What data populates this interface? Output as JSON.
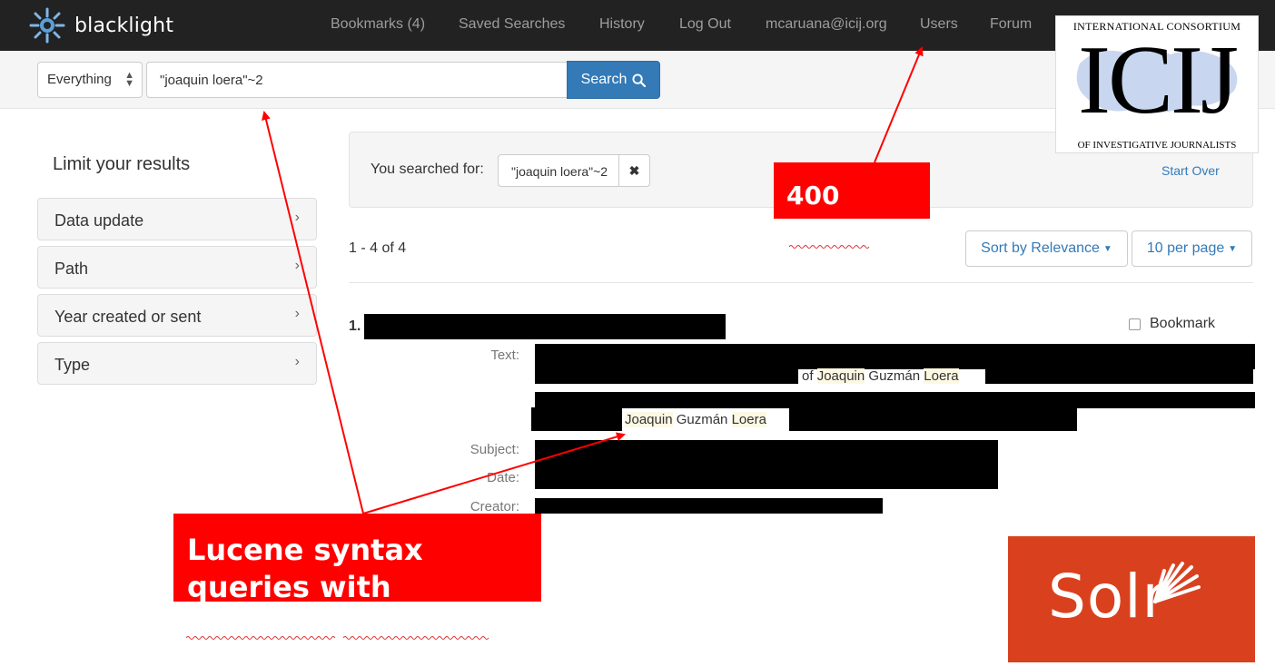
{
  "navbar": {
    "brand": "blacklight",
    "links": [
      "Bookmarks (4)",
      "Saved Searches",
      "History",
      "Log Out",
      "mcaruana@icij.org",
      "Users",
      "Forum"
    ]
  },
  "search": {
    "field": "Everything",
    "query": "\"joaquin loera\"~2",
    "button": "Search"
  },
  "sidebar": {
    "title": "Limit your results",
    "facets": [
      "Data update",
      "Path",
      "Year created or sent",
      "Type"
    ]
  },
  "constraints": {
    "label": "You searched for:",
    "value": "\"joaquin loera\"~2",
    "start_over": "Start Over"
  },
  "results": {
    "page_info": "1 - 4 of 4",
    "sort_label": "Sort by Relevance",
    "per_page_label": "10 per page",
    "doc": {
      "number": "1.",
      "bookmark": "Bookmark",
      "labels": {
        "text": "Text:",
        "subject": "Subject:",
        "date": "Date:",
        "creator": "Creator:"
      },
      "snippet1": {
        "pre": "of ",
        "w1": "Joaquin",
        "mid": " Guzmán ",
        "w2": "Loera"
      },
      "snippet2": {
        "w1": "Joaquin",
        "mid": " Guzmán ",
        "w2": "Loera"
      }
    }
  },
  "annotations": {
    "users_box": "400",
    "lucene_box_line1": "Lucene syntax",
    "lucene_box_line2": "queries with"
  },
  "logos": {
    "icij_top": "INTERNATIONAL CONSORTIUM",
    "icij_mark": "ICIJ",
    "icij_bottom": "OF INVESTIGATIVE JOURNALISTS",
    "solr": "Solr"
  },
  "colors": {
    "navbar": "#222222",
    "primary": "#337ab7",
    "annotation": "#ff0000",
    "highlight": "#fcf8e3",
    "solr": "#d9411e"
  }
}
